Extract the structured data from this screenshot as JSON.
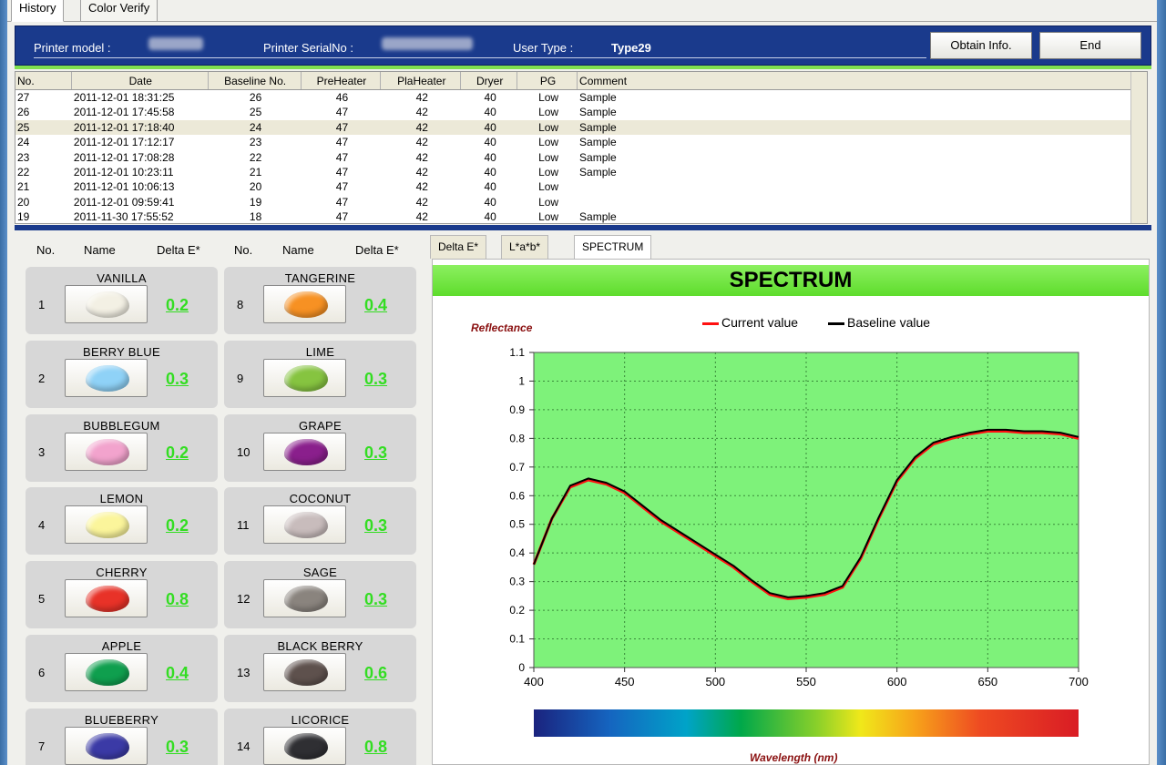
{
  "tabs": [
    {
      "label": "History",
      "active": true
    },
    {
      "label": "Color Verify",
      "active": false
    }
  ],
  "header": {
    "printer_model_label": "Printer model :",
    "printer_serial_label": "Printer SerialNo :",
    "user_type_label": "User Type :",
    "user_type_value": "Type29",
    "obtain_button": "Obtain Info.",
    "end_button": "End"
  },
  "table": {
    "columns": [
      "No.",
      "Date",
      "Baseline No.",
      "PreHeater",
      "PlaHeater",
      "Dryer",
      "PG",
      "Comment"
    ],
    "rows": [
      [
        "27",
        "2011-12-01 18:31:25",
        "26",
        "46",
        "42",
        "40",
        "Low",
        "Sample"
      ],
      [
        "26",
        "2011-12-01 17:45:58",
        "25",
        "47",
        "42",
        "40",
        "Low",
        "Sample"
      ],
      [
        "25",
        "2011-12-01 17:18:40",
        "24",
        "47",
        "42",
        "40",
        "Low",
        "Sample"
      ],
      [
        "24",
        "2011-12-01 17:12:17",
        "23",
        "47",
        "42",
        "40",
        "Low",
        "Sample"
      ],
      [
        "23",
        "2011-12-01 17:08:28",
        "22",
        "47",
        "42",
        "40",
        "Low",
        "Sample"
      ],
      [
        "22",
        "2011-12-01 10:23:11",
        "21",
        "47",
        "42",
        "40",
        "Low",
        "Sample"
      ],
      [
        "21",
        "2011-12-01 10:06:13",
        "20",
        "47",
        "42",
        "40",
        "Low",
        ""
      ],
      [
        "20",
        "2011-12-01 09:59:41",
        "19",
        "47",
        "42",
        "40",
        "Low",
        ""
      ],
      [
        "19",
        "2011-11-30 17:55:52",
        "18",
        "47",
        "42",
        "40",
        "Low",
        "Sample"
      ]
    ],
    "selected_row": 2
  },
  "colors": {
    "headers": [
      "No.",
      "Name",
      "Delta E*",
      "No.",
      "Name",
      "Delta E*"
    ],
    "items": [
      {
        "no": "1",
        "name": "VANILLA",
        "delta": "0.2",
        "color": "#f3f0e4"
      },
      {
        "no": "2",
        "name": "BERRY BLUE",
        "delta": "0.3",
        "color": "#8fd2f7"
      },
      {
        "no": "3",
        "name": "BUBBLEGUM",
        "delta": "0.2",
        "color": "#f2a3cd"
      },
      {
        "no": "4",
        "name": "LEMON",
        "delta": "0.2",
        "color": "#fbf59b"
      },
      {
        "no": "5",
        "name": "CHERRY",
        "delta": "0.8",
        "color": "#e83228"
      },
      {
        "no": "6",
        "name": "APPLE",
        "delta": "0.4",
        "color": "#0f9f4e"
      },
      {
        "no": "7",
        "name": "BLUEBERRY",
        "delta": "0.3",
        "color": "#3b3aa6"
      },
      {
        "no": "8",
        "name": "TANGERINE",
        "delta": "0.4",
        "color": "#f79123"
      },
      {
        "no": "9",
        "name": "LIME",
        "delta": "0.3",
        "color": "#86c440"
      },
      {
        "no": "10",
        "name": "GRAPE",
        "delta": "0.3",
        "color": "#8a1f8c"
      },
      {
        "no": "11",
        "name": "COCONUT",
        "delta": "0.3",
        "color": "#c8bcbc"
      },
      {
        "no": "12",
        "name": "SAGE",
        "delta": "0.3",
        "color": "#8a847e"
      },
      {
        "no": "13",
        "name": "BLACK BERRY",
        "delta": "0.6",
        "color": "#5e514d"
      },
      {
        "no": "14",
        "name": "LICORICE",
        "delta": "0.8",
        "color": "#2f2f33"
      }
    ]
  },
  "spectrum": {
    "tabs": [
      "Delta E*",
      "L*a*b*",
      "SPECTRUM"
    ],
    "active_tab": 2,
    "title": "SPECTRUM",
    "legend_current": "Current value",
    "legend_baseline": "Baseline value",
    "current_color": "#ff1010",
    "baseline_color": "#000000",
    "plot_bg": "#7ef27a",
    "ylabel": "Reflectance",
    "xlabel": "Wavelength (nm)"
  },
  "chart_data": {
    "type": "line",
    "title": "SPECTRUM",
    "xlabel": "Wavelength (nm)",
    "ylabel": "Reflectance",
    "xlim": [
      400,
      700
    ],
    "ylim": [
      0,
      1.1
    ],
    "grid": true,
    "legend": "top",
    "x_ticks": [
      "400",
      "450",
      "500",
      "550",
      "600",
      "650",
      "700"
    ],
    "y_ticks": [
      "0",
      "0.1",
      "0.2",
      "0.3",
      "0.4",
      "0.5",
      "0.6",
      "0.7",
      "0.8",
      "0.9",
      "1",
      "1.1"
    ],
    "x": [
      400,
      410,
      420,
      430,
      440,
      450,
      460,
      470,
      480,
      490,
      500,
      510,
      520,
      530,
      540,
      550,
      560,
      570,
      580,
      590,
      600,
      610,
      620,
      630,
      640,
      650,
      660,
      670,
      680,
      690,
      700
    ],
    "series": [
      {
        "name": "Current value",
        "values": [
          0.36,
          0.52,
          0.63,
          0.655,
          0.64,
          0.61,
          0.56,
          0.51,
          0.47,
          0.43,
          0.39,
          0.35,
          0.3,
          0.255,
          0.24,
          0.245,
          0.255,
          0.28,
          0.38,
          0.52,
          0.65,
          0.73,
          0.78,
          0.8,
          0.815,
          0.825,
          0.825,
          0.82,
          0.82,
          0.815,
          0.8
        ]
      },
      {
        "name": "Baseline value",
        "values": [
          0.36,
          0.52,
          0.635,
          0.66,
          0.645,
          0.615,
          0.565,
          0.515,
          0.475,
          0.435,
          0.395,
          0.355,
          0.305,
          0.26,
          0.245,
          0.25,
          0.26,
          0.285,
          0.385,
          0.525,
          0.655,
          0.735,
          0.785,
          0.805,
          0.82,
          0.83,
          0.83,
          0.825,
          0.825,
          0.82,
          0.805
        ]
      }
    ]
  }
}
